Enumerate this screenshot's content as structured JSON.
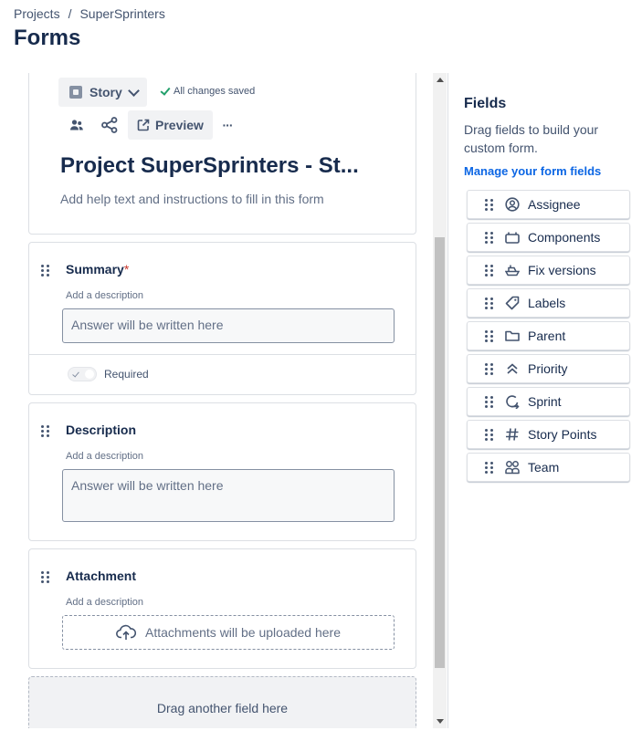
{
  "breadcrumb": {
    "items": [
      "Projects",
      "SuperSprinters"
    ],
    "separator": "/"
  },
  "page": {
    "title": "Forms"
  },
  "form_header": {
    "type_label": "Story",
    "saved_status": "All changes saved",
    "preview_label": "Preview",
    "more_label": "···",
    "title": "Project SuperSprinters - St...",
    "help_text": "Add help text and instructions to fill in this form"
  },
  "form_fields": [
    {
      "label": "Summary",
      "required_mark": "*",
      "description": "Add a description",
      "placeholder": "Answer will be written here",
      "required_label": "Required"
    },
    {
      "label": "Description",
      "description": "Add a description",
      "placeholder": "Answer will be written here"
    },
    {
      "label": "Attachment",
      "description": "Add a description",
      "placeholder": "Attachments will be uploaded here"
    }
  ],
  "drop_zone": {
    "label": "Drag another field here"
  },
  "fields_panel": {
    "heading": "Fields",
    "subtitle": "Drag fields to build your custom form.",
    "manage_link": "Manage your form fields",
    "items": [
      {
        "label": "Assignee",
        "icon": "person-circle-icon"
      },
      {
        "label": "Components",
        "icon": "component-icon"
      },
      {
        "label": "Fix versions",
        "icon": "ship-icon"
      },
      {
        "label": "Labels",
        "icon": "tag-icon"
      },
      {
        "label": "Parent",
        "icon": "folder-icon"
      },
      {
        "label": "Priority",
        "icon": "priority-chevrons-icon"
      },
      {
        "label": "Sprint",
        "icon": "sprint-icon"
      },
      {
        "label": "Story Points",
        "icon": "hash-icon"
      },
      {
        "label": "Team",
        "icon": "team-icon"
      }
    ]
  },
  "colors": {
    "accent_link": "#0c66e4",
    "required_star": "#c9372c",
    "saved_check": "#22a06b",
    "text_primary": "#172b4d"
  }
}
